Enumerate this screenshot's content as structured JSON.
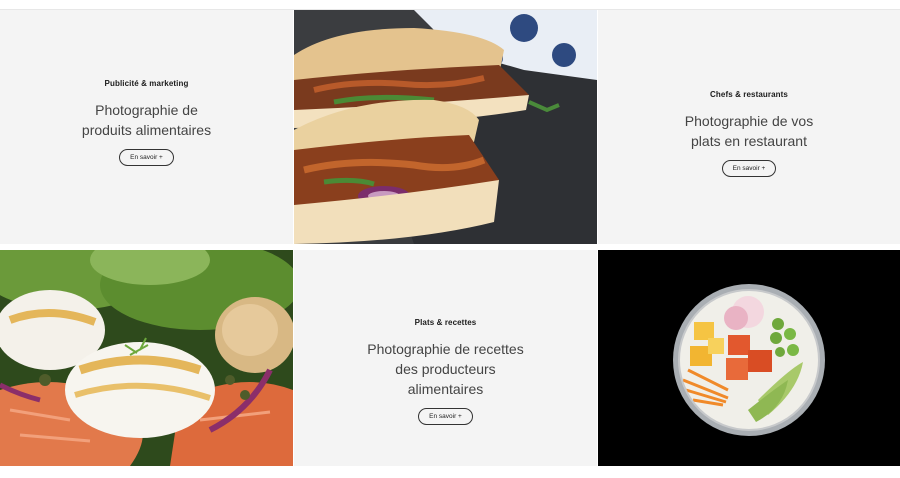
{
  "tiles": [
    {
      "category": "Publicité & marketing",
      "title": "Photographie de\nproduits alimentaires",
      "cta": "En savoir +"
    },
    {
      "category": "Chefs & restaurants",
      "title": "Photographie de vos\nplats en restaurant",
      "cta": "En savoir +"
    },
    {
      "category": "Plats & recettes",
      "title": "Photographie de recettes\ndes producteurs\nalimentaires",
      "cta": "En savoir +"
    }
  ],
  "images": {
    "sandwich": "pulled-pork-sandwich-photo",
    "salmon": "poached-egg-salmon-salad-photo",
    "poke": "poke-bowl-photo"
  },
  "colors": {
    "panel": "#f4f4f4",
    "black": "#000000",
    "text": "#444444"
  }
}
